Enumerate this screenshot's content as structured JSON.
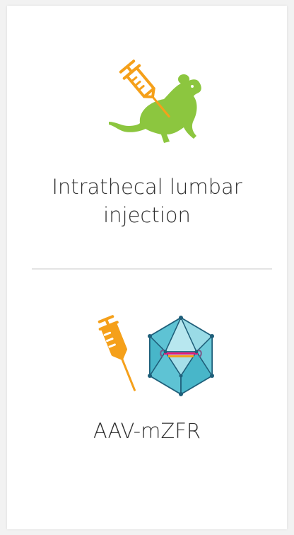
{
  "step1": {
    "icon": "syringe-rat-icon",
    "label": "Intrathecal lumbar injection"
  },
  "step2": {
    "icons": [
      "syringe-icon",
      "aav-capsid-icon"
    ],
    "label": "AAV-mZFR"
  },
  "colors": {
    "syringe": "#f5a01a",
    "rat": "#8cc63f",
    "capsid_fill": "#5ec3d4",
    "capsid_edge": "#1f5f7a",
    "text": "#2f2f2f",
    "divider": "#e4e4e4"
  }
}
